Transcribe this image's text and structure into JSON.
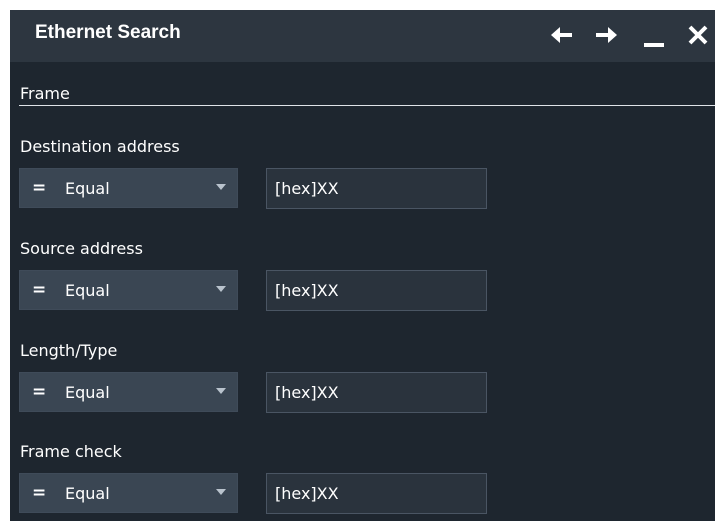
{
  "dialog": {
    "title": "Ethernet Search",
    "icons": [
      "arrow-left-icon",
      "arrow-right-icon",
      "minimize-icon",
      "close-icon"
    ]
  },
  "section": {
    "label": "Frame"
  },
  "rows": [
    {
      "label": "Destination address",
      "operator_symbol": "=",
      "operator": "Equal",
      "value": "[hex]XX"
    },
    {
      "label": "Source address",
      "operator_symbol": "=",
      "operator": "Equal",
      "value": "[hex]XX"
    },
    {
      "label": "Length/Type",
      "operator_symbol": "=",
      "operator": "Equal",
      "value": "[hex]XX"
    },
    {
      "label": "Frame check",
      "operator_symbol": "=",
      "operator": "Equal",
      "value": "[hex]XX"
    }
  ],
  "colors": {
    "background": "#1e262f",
    "titlebar": "#2d3640",
    "combo": "#3a4653",
    "field": "#2a333d",
    "text": "#ffffff"
  }
}
